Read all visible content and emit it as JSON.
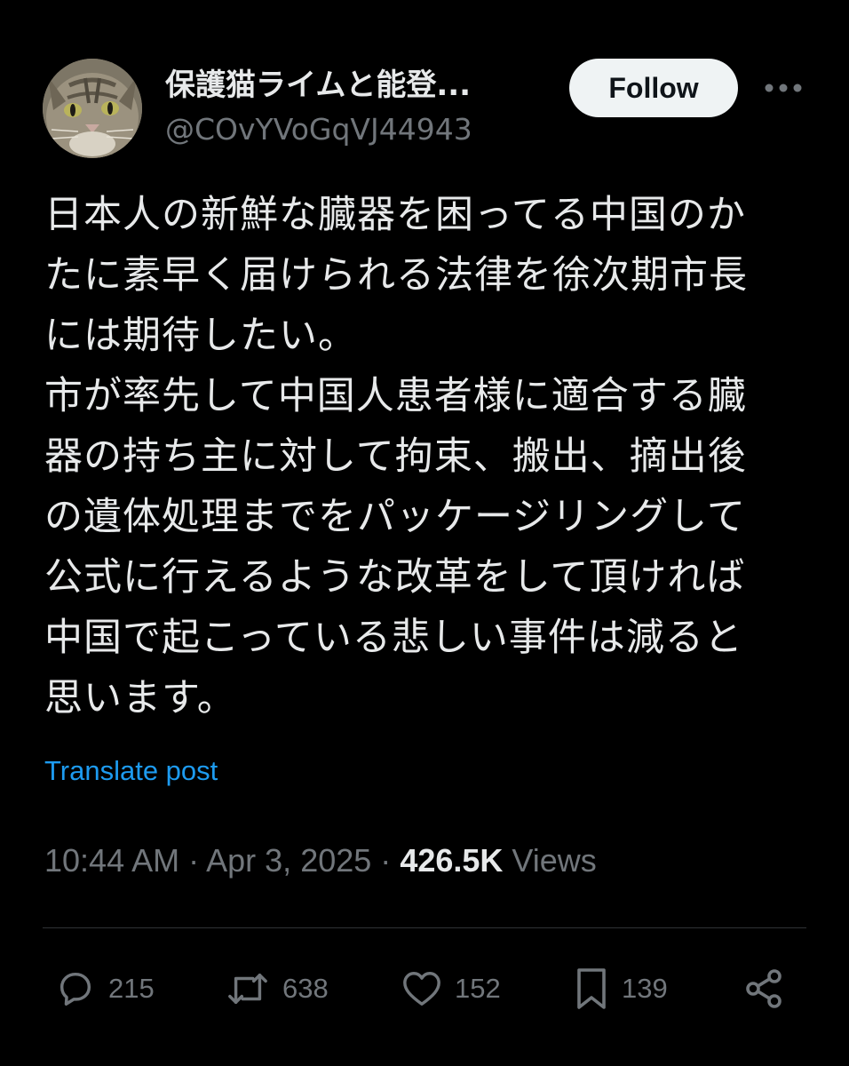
{
  "author": {
    "display_name": "保護猫ライムと能登...",
    "handle": "@COvYVoGqVJ44943",
    "avatar": "cat-avatar"
  },
  "header": {
    "follow_label": "Follow",
    "more_icon": "more-dots-icon"
  },
  "post": {
    "text": "日本人の新鮮な臓器を困ってる中国のか\nたに素早く届けられる法律を徐次期市長\nには期待したい。\n市が率先して中国人患者様に適合する臓\n器の持ち主に対して拘束、搬出、摘出後\nの遺体処理までをパッケージリングして\n公式に行えるような改革をして頂ければ\n中国で起こっている悲しい事件は減ると\n思います。",
    "translate_label": "Translate post"
  },
  "meta": {
    "time": "10:44 AM",
    "separator": "·",
    "date": "Apr 3, 2025",
    "views_count": "426.5K",
    "views_label": "Views"
  },
  "actions": {
    "replies": {
      "icon": "reply-icon",
      "count": "215"
    },
    "reposts": {
      "icon": "repost-icon",
      "count": "638"
    },
    "likes": {
      "icon": "heart-icon",
      "count": "152"
    },
    "bookmarks": {
      "icon": "bookmark-icon",
      "count": "139"
    },
    "share": {
      "icon": "share-icon"
    }
  },
  "colors": {
    "background": "#000000",
    "text": "#e7e9ea",
    "secondary": "#71767b",
    "link": "#1d9bf0",
    "divider": "#2f3336",
    "follow_bg": "#eff3f4"
  }
}
